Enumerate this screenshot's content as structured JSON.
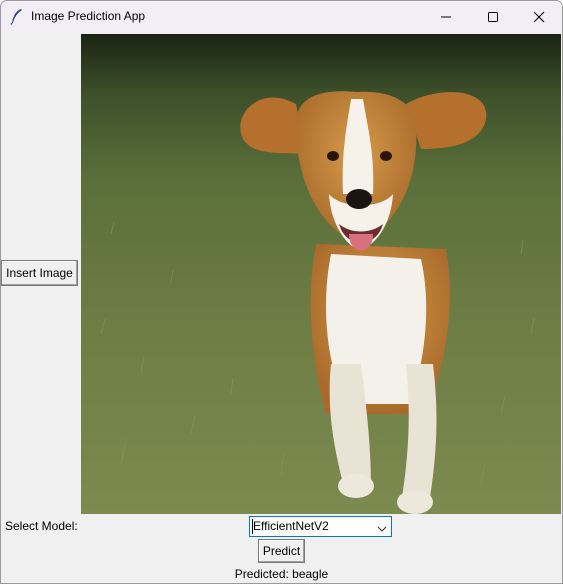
{
  "window": {
    "title": "Image Prediction App",
    "controls": [
      "minimize-icon",
      "maximize-icon",
      "close-icon"
    ]
  },
  "left_panel": {
    "insert_label": "Insert Image"
  },
  "image": {
    "subject": "beagle"
  },
  "model_select": {
    "label": "Select Model:",
    "value": "EfficientNetV2"
  },
  "actions": {
    "predict_label": "Predict"
  },
  "result": {
    "text": "Predicted: beagle"
  },
  "colors": {
    "titlebar": "#f3eef5",
    "client_bg": "#f0f0f0",
    "focus_border": "#0078d7"
  }
}
